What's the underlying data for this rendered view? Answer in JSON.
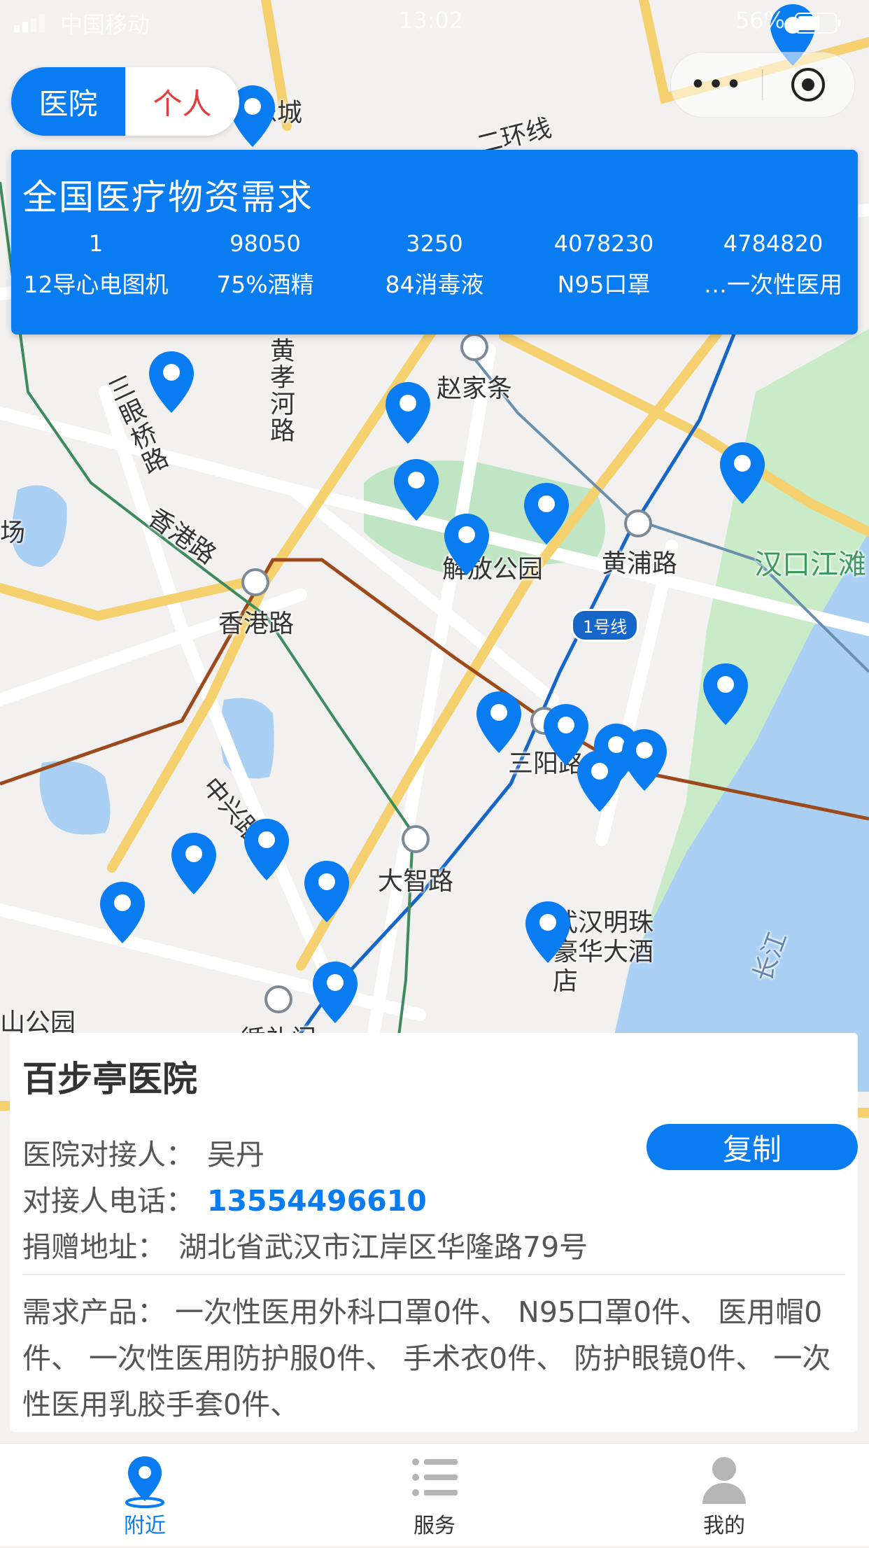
{
  "status_bar": {
    "carrier": "中国移动",
    "time": "13:02",
    "battery": "56%"
  },
  "mode_toggle": {
    "hospital": "医院",
    "personal": "个人"
  },
  "capsule": {
    "more": "•••"
  },
  "demand": {
    "title": "全国医疗物资需求",
    "items": [
      {
        "count": "1",
        "name": "12导心电图机"
      },
      {
        "count": "98050",
        "name": "75%酒精"
      },
      {
        "count": "3250",
        "name": "84消毒液"
      },
      {
        "count": "4078230",
        "name": "N95口罩"
      },
      {
        "count": "4784820",
        "name": "…一次性医用"
      }
    ]
  },
  "map": {
    "labels": {
      "zhaojiatiao": "赵家条",
      "huangpulu": "黄浦路",
      "hankou_jiangtan": "汉口江滩",
      "xianggang_lu_station": "香港路",
      "xianggang_lu_road": "香港路",
      "sanyanglu": "三阳路",
      "dazhilu": "大智路",
      "jiefang_park": "解放公园",
      "huangxiao_river": "黄孝河路",
      "sanyan_bridge": "三眼桥路",
      "hotel": "武汉明珠豪华大酒店",
      "xunli": "循礼门",
      "zhongshan_park": "山公园",
      "erhuan": "二环线",
      "line1": "1号线",
      "changjiang": "长江",
      "city": "乐城",
      "chang": "场",
      "road_zhongshan": "中兴路"
    }
  },
  "hospital": {
    "name": "百步亭医院",
    "contact_label": "医院对接人：",
    "contact_value": "吴丹",
    "copy_label": "复制",
    "phone_label": "对接人电话：",
    "phone_value": "13554496610",
    "address_label": "捐赠地址：",
    "address_value": "湖北省武汉市江岸区华隆路79号",
    "needs_label": "需求产品：",
    "needs_value": "一次性医用外科口罩0件、 N95口罩0件、 医用帽0件、 一次性医用防护服0件、 手术衣0件、 防护眼镜0件、 一次性医用乳胶手套0件、"
  },
  "tabs": [
    {
      "label": "附近",
      "icon": "location-icon",
      "active": true
    },
    {
      "label": "服务",
      "icon": "list-icon",
      "active": false
    },
    {
      "label": "我的",
      "icon": "user-icon",
      "active": false
    }
  ],
  "colors": {
    "accent": "#0a7cf2",
    "toggle_off_text": "#e43d3d",
    "river": "#a9cff3",
    "park": "#bfe5c4"
  }
}
